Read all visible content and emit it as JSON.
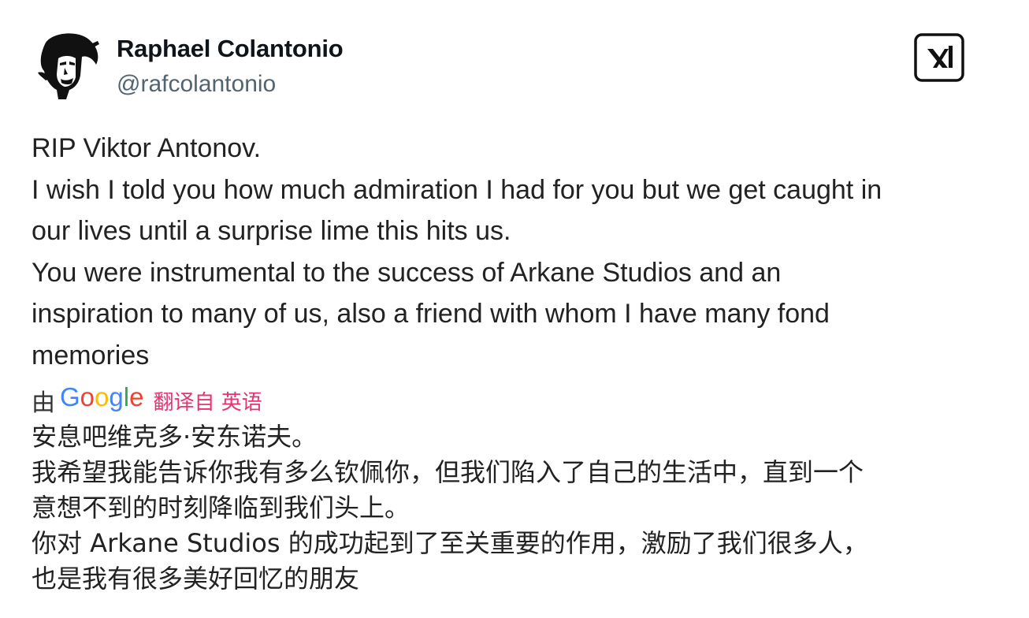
{
  "author": {
    "name": "Raphael Colantonio",
    "handle": "@rafcolantonio"
  },
  "platform_icon": "x-logo-icon",
  "tweet": {
    "lines": [
      "RIP Viktor Antonov.",
      "I wish I told you how much admiration I had for you but we get caught in",
      "our lives until a surprise lime this hits us.",
      "You were instrumental to the success of Arkane Studios and an",
      "inspiration to many of us, also a friend with whom I have many fond",
      "memories"
    ]
  },
  "translation": {
    "by_label": "由",
    "provider": "Google",
    "from_label": "翻译自 英语",
    "lines": [
      "安息吧维克多·安东诺夫。",
      "我希望我能告诉你我有多么钦佩你，但我们陷入了自己的生活中，直到一个",
      "意想不到的时刻降临到我们头上。",
      "你对 Arkane Studios 的成功起到了至关重要的作用，激励了我们很多人，",
      "也是我有很多美好回忆的朋友"
    ]
  },
  "colors": {
    "name": "#0f1419",
    "handle": "#536471",
    "translate_link": "#e8336f",
    "google_blue": "#4285f4",
    "google_red": "#ea4335",
    "google_yellow": "#fbbc05",
    "google_green": "#34a853"
  }
}
